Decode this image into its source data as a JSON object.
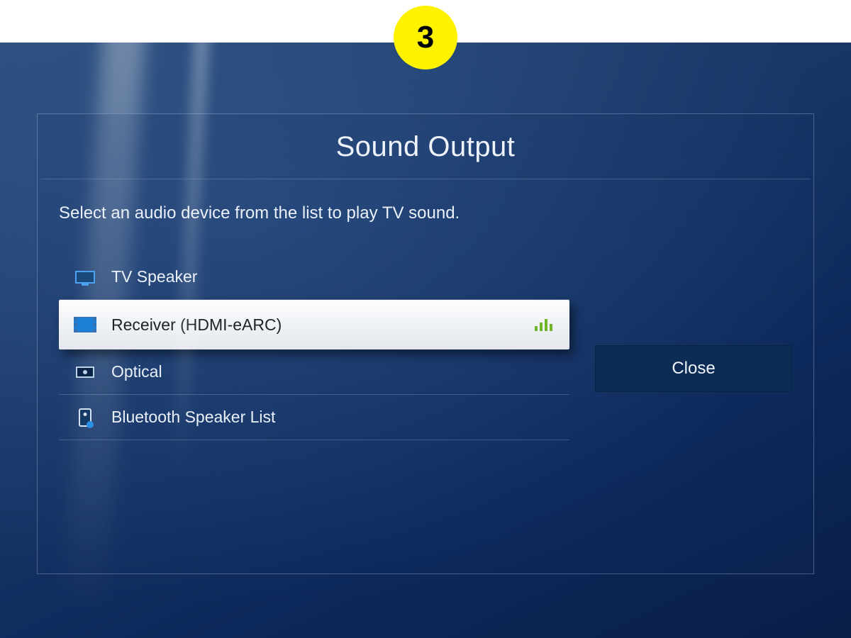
{
  "step_badge": "3",
  "panel": {
    "title": "Sound Output",
    "instruction": "Select an audio device from the list to play TV sound.",
    "options": [
      {
        "label": "TV Speaker",
        "icon": "tv-speaker-icon",
        "selected": false,
        "active_indicator": false
      },
      {
        "label": "Receiver (HDMI-eARC)",
        "icon": "receiver-icon",
        "selected": true,
        "active_indicator": true
      },
      {
        "label": "Optical",
        "icon": "optical-icon",
        "selected": false,
        "active_indicator": false
      },
      {
        "label": "Bluetooth Speaker List",
        "icon": "bluetooth-speaker-icon",
        "selected": false,
        "active_indicator": false
      }
    ],
    "close_label": "Close"
  },
  "colors": {
    "accent_yellow": "#fff200",
    "bg_deep_blue": "#0d285a",
    "highlight_bg": "#f3f5f8",
    "activity_green": "#6fb52a"
  }
}
